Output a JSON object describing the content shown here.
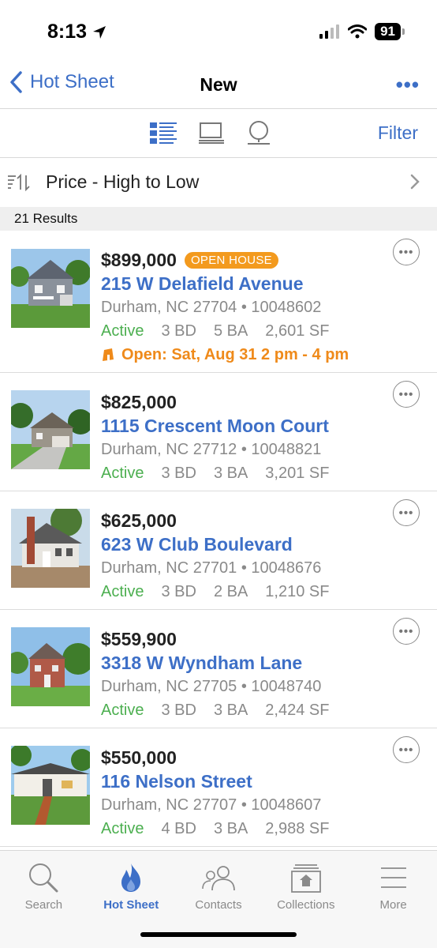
{
  "status_bar": {
    "time": "8:13",
    "battery": "91"
  },
  "nav": {
    "back_label": "Hot Sheet",
    "title": "New",
    "more": "•••"
  },
  "toolbar": {
    "filter_label": "Filter"
  },
  "sort": {
    "label": "Price - High to Low"
  },
  "results": {
    "count_label": "21 Results"
  },
  "listings": [
    {
      "price": "$899,000",
      "badge": "OPEN HOUSE",
      "address": "215 W Delafield Avenue",
      "location": "Durham, NC 27704 • 10048602",
      "status": "Active",
      "beds": "3 BD",
      "baths": "5 BA",
      "sqft": "2,601 SF",
      "open_house": "Open: Sat, Aug 31 2 pm - 4 pm"
    },
    {
      "price": "$825,000",
      "address": "1115 Crescent Moon Court",
      "location": "Durham, NC 27712 • 10048821",
      "status": "Active",
      "beds": "3 BD",
      "baths": "3 BA",
      "sqft": "3,201 SF"
    },
    {
      "price": "$625,000",
      "address": "623 W Club Boulevard",
      "location": "Durham, NC 27701 • 10048676",
      "status": "Active",
      "beds": "3 BD",
      "baths": "2 BA",
      "sqft": "1,210 SF"
    },
    {
      "price": "$559,900",
      "address": "3318 W Wyndham Lane",
      "location": "Durham, NC 27705 • 10048740",
      "status": "Active",
      "beds": "3 BD",
      "baths": "3 BA",
      "sqft": "2,424 SF"
    },
    {
      "price": "$550,000",
      "address": "116 Nelson Street",
      "location": "Durham, NC 27707 • 10048607",
      "status": "Active",
      "beds": "4 BD",
      "baths": "3 BA",
      "sqft": "2,988 SF"
    }
  ],
  "tabs": [
    {
      "label": "Search",
      "icon": "search-icon"
    },
    {
      "label": "Hot Sheet",
      "icon": "flame-icon",
      "active": true
    },
    {
      "label": "Contacts",
      "icon": "contacts-icon"
    },
    {
      "label": "Collections",
      "icon": "collections-icon"
    },
    {
      "label": "More",
      "icon": "menu-icon"
    }
  ],
  "colors": {
    "accent": "#3d6fc7",
    "active": "#4caf50",
    "open_house": "#ef8a1a",
    "badge": "#f39a1e"
  }
}
